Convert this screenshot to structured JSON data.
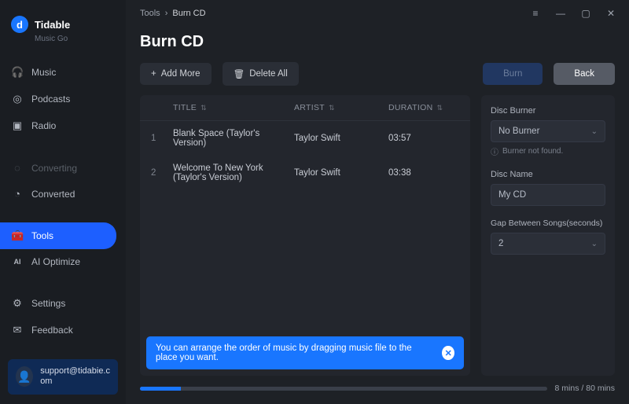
{
  "brand": {
    "name": "Tidable",
    "sub": "Music Go",
    "logo_letter": "d"
  },
  "sidebar": {
    "items": [
      {
        "icon": "🎧",
        "label": "Music"
      },
      {
        "icon": "◎",
        "label": "Podcasts"
      },
      {
        "icon": "▣",
        "label": "Radio"
      }
    ],
    "group2": [
      {
        "icon": "◌",
        "label": "Converting",
        "dim": true
      },
      {
        "icon": "◔",
        "label": "Converted"
      }
    ],
    "group3": [
      {
        "icon": "🧰",
        "label": "Tools",
        "active": true
      },
      {
        "icon": "AI",
        "label": "AI Optimize"
      }
    ],
    "group4": [
      {
        "icon": "⚙",
        "label": "Settings"
      },
      {
        "icon": "✉",
        "label": "Feedback"
      }
    ]
  },
  "support": {
    "email": "support@tidabie.com"
  },
  "breadcrumbs": [
    "Tools",
    "Burn CD"
  ],
  "page_title": "Burn CD",
  "toolbar": {
    "add_more": "Add More",
    "delete_all": "Delete All",
    "burn": "Burn",
    "back": "Back"
  },
  "columns": {
    "title": "TITLE",
    "artist": "ARTIST",
    "duration": "DURATION"
  },
  "tracks": [
    {
      "n": "1",
      "title": "Blank Space (Taylor's Version)",
      "artist": "Taylor Swift",
      "duration": "03:57"
    },
    {
      "n": "2",
      "title": "Welcome To New York (Taylor's Version)",
      "artist": "Taylor Swift",
      "duration": "03:38"
    }
  ],
  "hint": "You can arrange the order of music by dragging music file to the place you want.",
  "side": {
    "disc_burner_label": "Disc Burner",
    "disc_burner_value": "No Burner",
    "burner_helper": "Burner not found.",
    "disc_name_label": "Disc Name",
    "disc_name_value": "My CD",
    "gap_label": "Gap Between Songs(seconds)",
    "gap_value": "2"
  },
  "progress": {
    "percent": 10,
    "label": "8 mins / 80 mins"
  }
}
